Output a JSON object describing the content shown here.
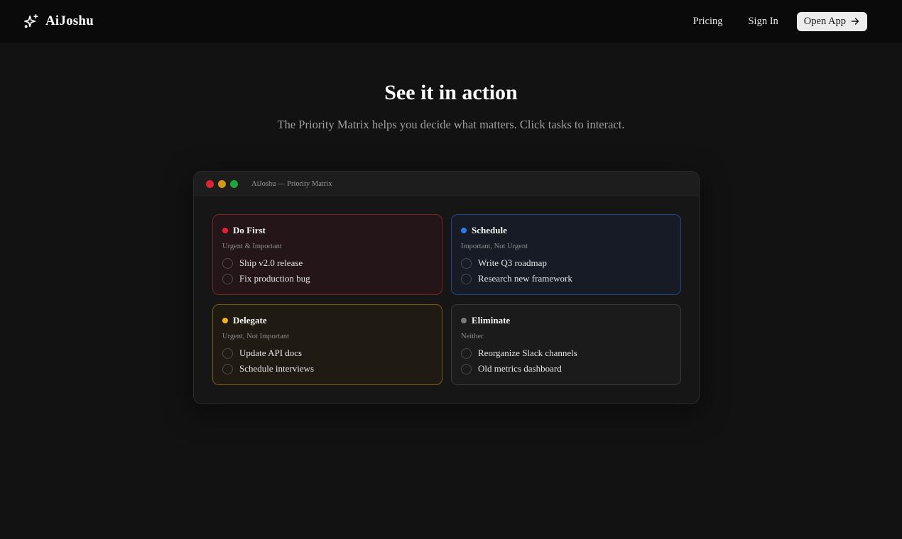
{
  "header": {
    "brand": "AiJoshu",
    "nav": {
      "pricing": "Pricing",
      "sign_in": "Sign In",
      "open_app": "Open App"
    }
  },
  "hero": {
    "title": "See it in action",
    "subtitle": "The Priority Matrix helps you decide what matters. Click tasks to interact."
  },
  "window": {
    "title": "AiJoshu — Priority Matrix",
    "quadrants": [
      {
        "id": "do-first",
        "title": "Do First",
        "desc": "Urgent & Important",
        "color": "#ef1c37",
        "tasks": [
          "Ship v2.0 release",
          "Fix production bug"
        ]
      },
      {
        "id": "schedule",
        "title": "Schedule",
        "desc": "Important, Not Urgent",
        "color": "#2a7df0",
        "tasks": [
          "Write Q3 roadmap",
          "Research new framework"
        ]
      },
      {
        "id": "delegate",
        "title": "Delegate",
        "desc": "Urgent, Not Important",
        "color": "#f0b518",
        "tasks": [
          "Update API docs",
          "Schedule interviews"
        ]
      },
      {
        "id": "eliminate",
        "title": "Eliminate",
        "desc": "Neither",
        "color": "#7a7a7a",
        "tasks": [
          "Reorganize Slack channels",
          "Old metrics dashboard"
        ]
      }
    ]
  },
  "icons": {
    "brand": "sparkles-icon",
    "open_app": "arrow-right-icon"
  }
}
